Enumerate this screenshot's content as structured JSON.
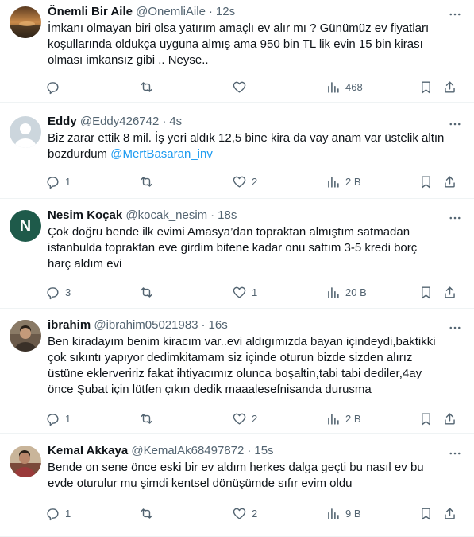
{
  "colors": {
    "text": "#0f1419",
    "muted": "#536471",
    "link": "#1d9bf0",
    "divider": "#eff3f4"
  },
  "tweets": [
    {
      "name": "Önemli Bir Aile",
      "handle": "@OnemliAile",
      "dot": "·",
      "time": "12s",
      "lines": [
        "İmkanı olmayan biri olsa yatırım amaçlı ev alır mı ? Günümüz ev fiyatları",
        "koşullarında oldukça uyguna almış ama 950 bin TL lik evin 15 bin kirası",
        "olması imkansız gibi .. Neyse.."
      ],
      "replies": "",
      "retweets": "",
      "likes": "",
      "views": "468",
      "avatar": "sunset-photo"
    },
    {
      "name": "Eddy",
      "handle": "@Eddy426742",
      "dot": "·",
      "time": "4s",
      "lines": [
        "Biz zarar ettik 8 mil. İş yeri aldık 12,5 bine kira da vay anam var üstelik altın",
        "bozdurdum "
      ],
      "mention": "@MertBasaran_inv",
      "replies": "1",
      "retweets": "",
      "likes": "2",
      "views": "2 B",
      "avatar": "default-profile"
    },
    {
      "name": "Nesim Koçak",
      "handle": "@kocak_nesim",
      "dot": "·",
      "time": "18s",
      "lines": [
        "Çok doğru bende ilk evimi Amasya’dan topraktan almıştım satmadan",
        "istanbulda topraktan eve girdim bitene kadar onu sattım 3-5 kredi borç",
        "harç aldım evi"
      ],
      "replies": "3",
      "retweets": "",
      "likes": "1",
      "views": "20 B",
      "avatar_letter": "N",
      "avatar_color": "#1e5a4a"
    },
    {
      "name": "ibrahim",
      "handle": "@ibrahim05021983",
      "dot": "·",
      "time": "16s",
      "lines": [
        "Ben kiradayım benim kiracım var..evi aldıgımızda bayan içindeydi,baktikki",
        "çok sıkıntı yapıyor dedimkitamam siz içinde oturun bizde sizden alırız",
        "üstüne eklerveririz fakat ihtiyacımız olunca boşaltin,tabi tabi dediler,4ay",
        "önce Şubat için lütfen çıkın dedik maaalesefnisanda durusma"
      ],
      "replies": "1",
      "retweets": "",
      "likes": "2",
      "views": "2 B",
      "avatar": "person-photo"
    },
    {
      "name": "Kemal Akkaya",
      "handle": "@KemalAk68497872",
      "dot": "·",
      "time": "15s",
      "lines": [
        "Bende on sene  önce eski bir ev aldım herkes  dalga geçti bu nasıl ev bu",
        "evde oturulur mu şimdi kentsel dönüşümde sıfır evim oldu"
      ],
      "replies": "1",
      "retweets": "",
      "likes": "2",
      "views": "9 B",
      "avatar": "person-photo"
    }
  ]
}
